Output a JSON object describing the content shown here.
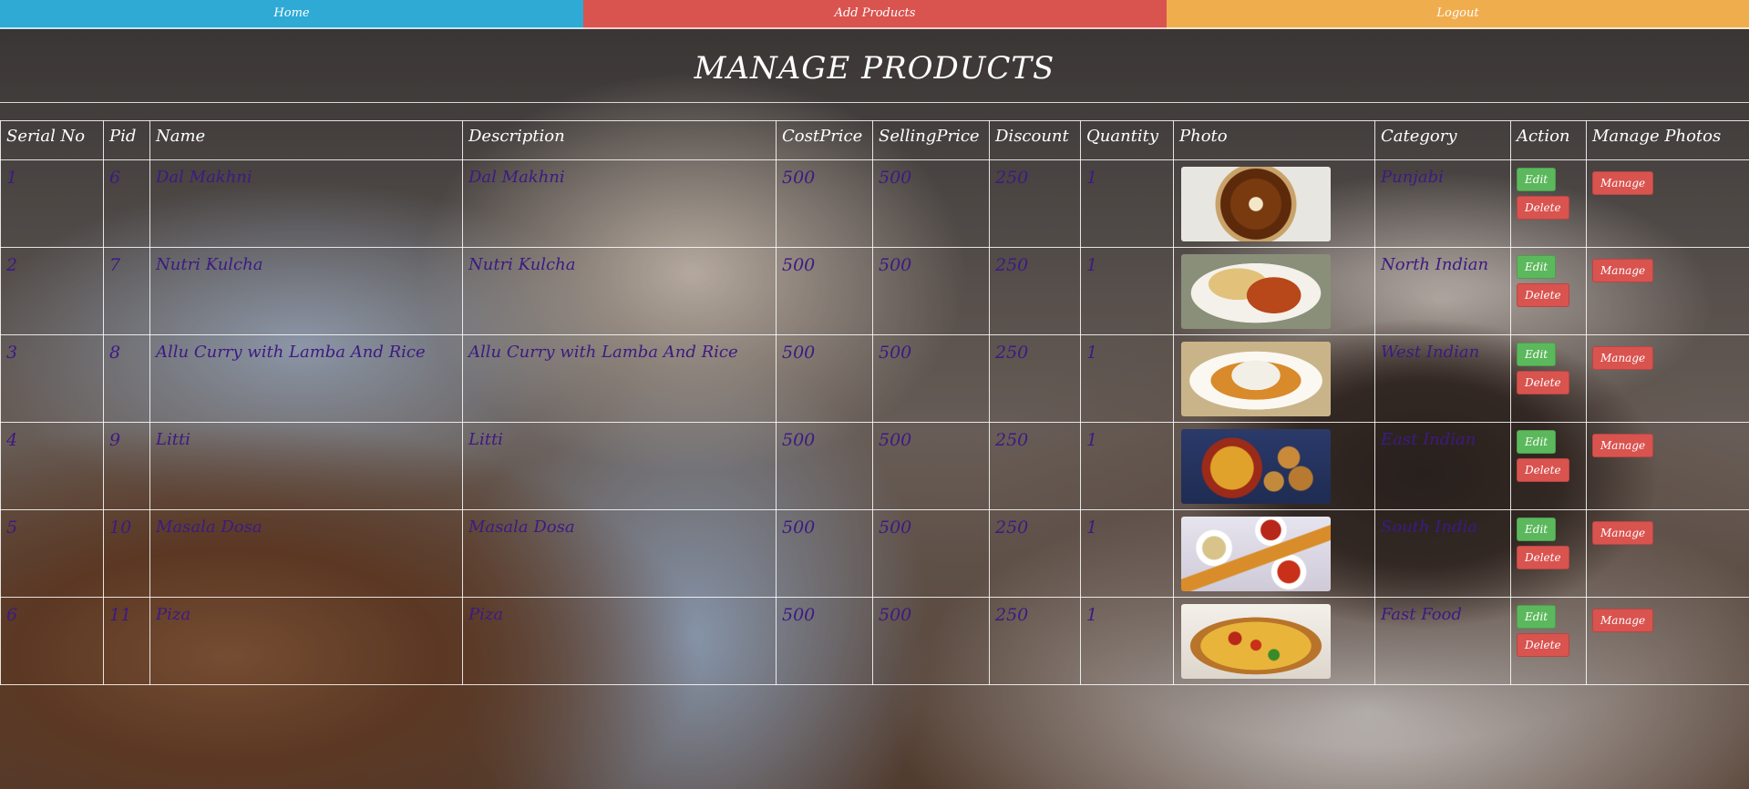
{
  "nav": {
    "home": "Home",
    "add_products": "Add Products",
    "logout": "Logout"
  },
  "page_title": "MANAGE PRODUCTS",
  "columns": [
    "Serial No",
    "Pid",
    "Name",
    "Description",
    "CostPrice",
    "SellingPrice",
    "Discount",
    "Quantity",
    "Photo",
    "Category",
    "Action",
    "Manage Photos"
  ],
  "buttons": {
    "edit": "Edit",
    "delete": "Delete",
    "manage": "Manage"
  },
  "rows": [
    {
      "serial": "1",
      "pid": "6",
      "name": "Dal Makhni",
      "description": "Dal Makhni",
      "cost": "500",
      "selling": "500",
      "discount": "250",
      "quantity": "1",
      "photo": "dal-makhni-photo",
      "category": "Punjabi"
    },
    {
      "serial": "2",
      "pid": "7",
      "name": "Nutri Kulcha",
      "description": "Nutri Kulcha",
      "cost": "500",
      "selling": "500",
      "discount": "250",
      "quantity": "1",
      "photo": "nutri-kulcha-photo",
      "category": "North Indian"
    },
    {
      "serial": "3",
      "pid": "8",
      "name": "Allu Curry with Lamba And Rice",
      "description": "Allu Curry with Lamba And Rice",
      "cost": "500",
      "selling": "500",
      "discount": "250",
      "quantity": "1",
      "photo": "allu-curry-photo",
      "category": "West Indian"
    },
    {
      "serial": "4",
      "pid": "9",
      "name": "Litti",
      "description": "Litti",
      "cost": "500",
      "selling": "500",
      "discount": "250",
      "quantity": "1",
      "photo": "litti-photo",
      "category": "East Indian"
    },
    {
      "serial": "5",
      "pid": "10",
      "name": "Masala Dosa",
      "description": "Masala Dosa",
      "cost": "500",
      "selling": "500",
      "discount": "250",
      "quantity": "1",
      "photo": "masala-dosa-photo",
      "category": "South India"
    },
    {
      "serial": "6",
      "pid": "11",
      "name": "Piza",
      "description": "Piza",
      "cost": "500",
      "selling": "500",
      "discount": "250",
      "quantity": "1",
      "photo": "pizza-photo",
      "category": "Fast Food"
    }
  ]
}
